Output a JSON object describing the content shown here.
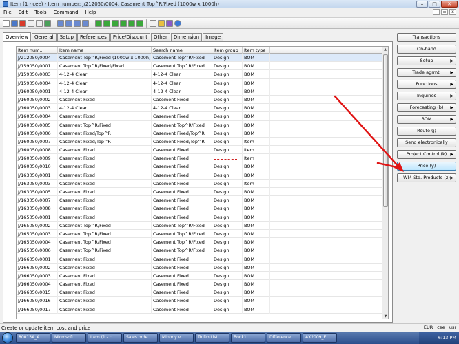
{
  "window": {
    "title": "Item (1 - cee) - Item number: J/212050/0004, Casement Top^R/Fixed (1000w x 1000h)"
  },
  "menu": [
    "File",
    "Edit",
    "Tools",
    "Command",
    "Help"
  ],
  "tabs": [
    "Overview",
    "General",
    "Setup",
    "References",
    "Price/Discount",
    "Other",
    "Dimension",
    "Image"
  ],
  "grid": {
    "columns": [
      "Item num...",
      "Item name",
      "Search name",
      "Item group",
      "Item type"
    ],
    "rows": [
      [
        "J/212050/0004",
        "Casement Top^R/Fixed (1000w x 1000h)",
        "Casement Top^R/Fixed",
        "Design",
        "BOM"
      ],
      [
        "J/159050/0001",
        "Casement Top^R/Fixed/Fixed",
        "Casement Top^R/Fixed",
        "Design",
        "BOM"
      ],
      [
        "J/159050/0003",
        "4-12-4 Clear",
        "4-12-4 Clear",
        "Design",
        "BOM"
      ],
      [
        "J/159050/0004",
        "4-12-4 Clear",
        "4-12-4 Clear",
        "Design",
        "BOM"
      ],
      [
        "J/160050/0001",
        "4-12-4 Clear",
        "4-12-4 Clear",
        "Design",
        "BOM"
      ],
      [
        "J/160050/0002",
        "Casement Fixed",
        "Casement Fixed",
        "Design",
        "BOM"
      ],
      [
        "J/160050/0003",
        "4-12-4 Clear",
        "4-12-4 Clear",
        "Design",
        "BOM"
      ],
      [
        "J/160050/0004",
        "Casement Fixed",
        "Casement Fixed",
        "Design",
        "BOM"
      ],
      [
        "J/160050/0005",
        "Casement Top^R/Fixed",
        "Casement Top^R/Fixed",
        "Design",
        "BOM"
      ],
      [
        "J/160050/0006",
        "Casement Fixed/Top^R",
        "Casement Fixed/Top^R",
        "Design",
        "BOM"
      ],
      [
        "J/160050/0007",
        "Casement Fixed/Top^R",
        "Casement Fixed/Top^R",
        "Design",
        "Item"
      ],
      [
        "J/160050/0008",
        "Casement Fixed",
        "Casement Fixed",
        "Design",
        "Item"
      ],
      [
        "J/160050/0009",
        "Casement Fixed",
        "Casement Fixed",
        "",
        "Item"
      ],
      [
        "J/160050/0010",
        "Casement Fixed",
        "Casement Fixed",
        "Design",
        "BOM"
      ],
      [
        "J/163050/0001",
        "Casement Fixed",
        "Casement Fixed",
        "Design",
        "BOM"
      ],
      [
        "J/163050/0003",
        "Casement Fixed",
        "Casement Fixed",
        "Design",
        "Item"
      ],
      [
        "J/163050/0005",
        "Casement Fixed",
        "Casement Fixed",
        "Design",
        "BOM"
      ],
      [
        "J/163050/0007",
        "Casement Fixed",
        "Casement Fixed",
        "Design",
        "BOM"
      ],
      [
        "J/163050/0008",
        "Casement Fixed",
        "Casement Fixed",
        "Design",
        "BOM"
      ],
      [
        "J/165050/0001",
        "Casement Fixed",
        "Casement Fixed",
        "Design",
        "BOM"
      ],
      [
        "J/165050/0002",
        "Casement Top^R/Fixed",
        "Casement Top^R/Fixed",
        "Design",
        "BOM"
      ],
      [
        "J/165050/0003",
        "Casement Top^R/Fixed",
        "Casement Top^R/Fixed",
        "Design",
        "BOM"
      ],
      [
        "J/165050/0004",
        "Casement Top^R/Fixed",
        "Casement Top^R/Fixed",
        "Design",
        "BOM"
      ],
      [
        "J/165050/0006",
        "Casement Top^R/Fixed",
        "Casement Top^R/Fixed",
        "Design",
        "BOM"
      ],
      [
        "J/166050/0001",
        "Casement Fixed",
        "Casement Fixed",
        "Design",
        "BOM"
      ],
      [
        "J/166050/0002",
        "Casement Fixed",
        "Casement Fixed",
        "Design",
        "BOM"
      ],
      [
        "J/166050/0003",
        "Casement Fixed",
        "Casement Fixed",
        "Design",
        "BOM"
      ],
      [
        "J/166050/0004",
        "Casement Fixed",
        "Casement Fixed",
        "Design",
        "BOM"
      ],
      [
        "J/166050/0015",
        "Casement Fixed",
        "Casement Fixed",
        "Design",
        "BOM"
      ],
      [
        "J/166050/0016",
        "Casement Fixed",
        "Casement Fixed",
        "Design",
        "BOM"
      ],
      [
        "J/166050/0017",
        "Casement Fixed",
        "Casement Fixed",
        "Design",
        "BOM"
      ]
    ]
  },
  "side_buttons": [
    {
      "label": "Transactions",
      "caret": false
    },
    {
      "label": "On-hand",
      "caret": false
    },
    {
      "label": "Setup",
      "caret": true
    },
    {
      "label": "Trade agrmt.",
      "caret": true
    },
    {
      "label": "Functions",
      "caret": true
    },
    {
      "label": "Inquiries",
      "caret": true
    },
    {
      "label": "Forecasting (b)",
      "caret": true
    },
    {
      "label": "BOM",
      "caret": true
    },
    {
      "label": "Route (j)",
      "caret": false
    },
    {
      "label": "Send electronically",
      "caret": false
    },
    {
      "label": "Project Control (k)",
      "caret": true
    },
    {
      "label": "Price (y)",
      "caret": false,
      "highlighted": true
    },
    {
      "label": "WM Std. Products (z)",
      "caret": true
    }
  ],
  "status": {
    "message": "Create or update item cost and price",
    "currency": "EUR",
    "company": "cee",
    "user": "usr"
  },
  "taskbar": {
    "items": [
      "80013A_A...",
      "Microsoft ...",
      "Item (1 - c...",
      "Sales orde...",
      "Mipony v...",
      "To Do List...",
      "Book1",
      "Difference...",
      "AX2009_E..."
    ],
    "clock": "6:13 PM"
  },
  "colors": {
    "annotation_arrow": "#e01515",
    "selection": "#dce9f9",
    "taskbar": "#2c4e8c"
  }
}
